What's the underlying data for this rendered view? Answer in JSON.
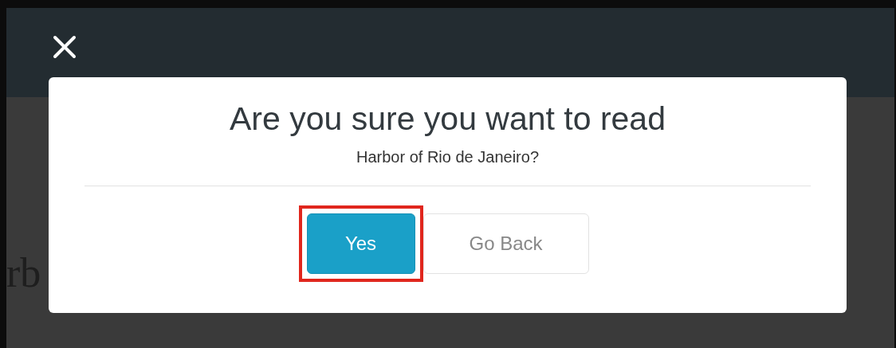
{
  "page": {
    "heading": "rb"
  },
  "dialog": {
    "title": "Are you sure you want to read",
    "subtitle": "Harbor of Rio de Janeiro?",
    "buttons": [
      {
        "label": "Yes",
        "kind": "primary",
        "highlighted": true
      },
      {
        "label": "Go Back",
        "kind": "secondary",
        "highlighted": false
      }
    ]
  }
}
